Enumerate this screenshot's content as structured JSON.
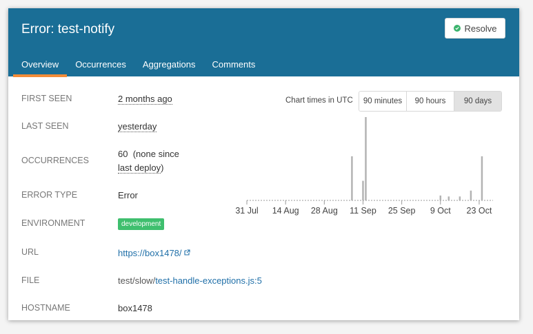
{
  "header": {
    "title": "Error: test-notify",
    "resolve_label": "Resolve",
    "brand_color": "#1a6e96",
    "tabs": [
      {
        "label": "Overview",
        "active": true
      },
      {
        "label": "Occurrences",
        "active": false
      },
      {
        "label": "Aggregations",
        "active": false
      },
      {
        "label": "Comments",
        "active": false
      }
    ]
  },
  "details": {
    "first_seen_label": "FIRST SEEN",
    "first_seen_value": "2 months ago",
    "last_seen_label": "LAST SEEN",
    "last_seen_value": "yesterday",
    "occurrences_label": "OCCURRENCES",
    "occurrences_count": "60",
    "occurrences_note": "(none since",
    "occurrences_link": "last deploy",
    "occurrences_close": ")",
    "error_type_label": "ERROR TYPE",
    "error_type_value": "Error",
    "environment_label": "ENVIRONMENT",
    "environment_value": "development",
    "url_label": "URL",
    "url_value": "https://box1478/",
    "file_label": "FILE",
    "file_prefix": "test/slow/",
    "file_link": "test-handle-exceptions.js:5",
    "hostname_label": "HOSTNAME",
    "hostname_value": "box1478"
  },
  "chart_controls": {
    "caption": "Chart times in UTC",
    "options": [
      "90 minutes",
      "90 hours",
      "90 days"
    ],
    "selected": "90 days"
  },
  "chart_data": {
    "type": "bar",
    "x_tick_labels": [
      "31 Jul",
      "14 Aug",
      "28 Aug",
      "11 Sep",
      "25 Sep",
      "9 Oct",
      "23 Oct"
    ],
    "bars": [
      {
        "day": 38,
        "value": 9
      },
      {
        "day": 42,
        "value": 4
      },
      {
        "day": 43,
        "value": 17
      },
      {
        "day": 70,
        "value": 1
      },
      {
        "day": 73,
        "value": 0.8
      },
      {
        "day": 77,
        "value": 0.8
      },
      {
        "day": 81,
        "value": 2
      },
      {
        "day": 85,
        "value": 9
      }
    ],
    "ymax": 17,
    "days_total": 89,
    "grid": false,
    "bar_color": "#b3b3b3"
  }
}
